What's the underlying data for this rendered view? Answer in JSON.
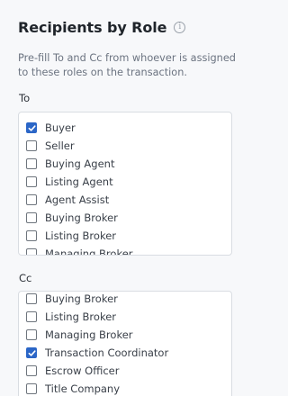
{
  "panel": {
    "title": "Recipients by Role",
    "info_icon": "info-icon",
    "description": "Pre-fill To and Cc from whoever is assigned to these roles on the transaction."
  },
  "to": {
    "label": "To",
    "items": [
      {
        "label": "Buyer",
        "checked": true
      },
      {
        "label": "Seller",
        "checked": false
      },
      {
        "label": "Buying Agent",
        "checked": false
      },
      {
        "label": "Listing Agent",
        "checked": false
      },
      {
        "label": "Agent Assist",
        "checked": false
      },
      {
        "label": "Buying Broker",
        "checked": false
      },
      {
        "label": "Listing Broker",
        "checked": false
      },
      {
        "label": "Managing Broker",
        "checked": false
      }
    ]
  },
  "cc": {
    "label": "Cc",
    "items": [
      {
        "label": "Buying Broker",
        "checked": false
      },
      {
        "label": "Listing Broker",
        "checked": false
      },
      {
        "label": "Managing Broker",
        "checked": false
      },
      {
        "label": "Transaction Coordinator",
        "checked": true
      },
      {
        "label": "Escrow Officer",
        "checked": false
      },
      {
        "label": "Title Company",
        "checked": false
      }
    ]
  },
  "colors": {
    "accent": "#2b66c7",
    "border": "#d9dde2",
    "background": "#f7f8fa"
  }
}
